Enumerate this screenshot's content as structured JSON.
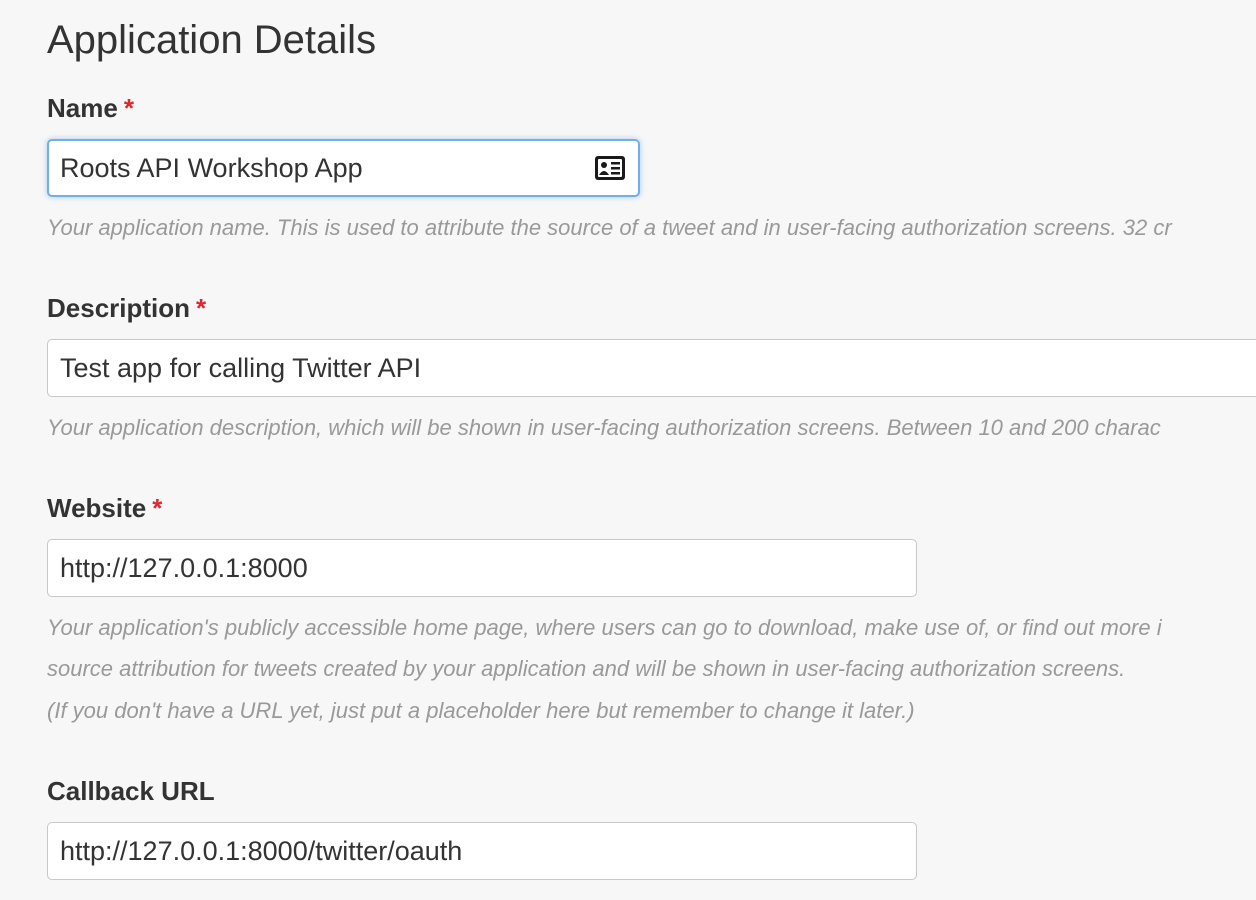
{
  "section": {
    "title": "Application Details"
  },
  "fields": {
    "name": {
      "label": "Name",
      "required_mark": "*",
      "value": "Roots API Workshop App",
      "help": "Your application name. This is used to attribute the source of a tweet and in user-facing authorization screens. 32 cr"
    },
    "description": {
      "label": "Description",
      "required_mark": "*",
      "value": "Test app for calling Twitter API",
      "help": "Your application description, which will be shown in user-facing authorization screens. Between 10 and 200 charac"
    },
    "website": {
      "label": "Website",
      "required_mark": "*",
      "value": "http://127.0.0.1:8000",
      "help_lines": [
        "Your application's publicly accessible home page, where users can go to download, make use of, or find out more i",
        "source attribution for tweets created by your application and will be shown in user-facing authorization screens.",
        "(If you don't have a URL yet, just put a placeholder here but remember to change it later.)"
      ]
    },
    "callback": {
      "label": "Callback URL",
      "value": "http://127.0.0.1:8000/twitter/oauth"
    }
  },
  "icons": {
    "name_field_icon": "contact-card-icon"
  },
  "colors": {
    "required": "#e0262f",
    "focus_border": "#74aee8",
    "help_text": "#999999",
    "background": "#f7f7f7"
  }
}
